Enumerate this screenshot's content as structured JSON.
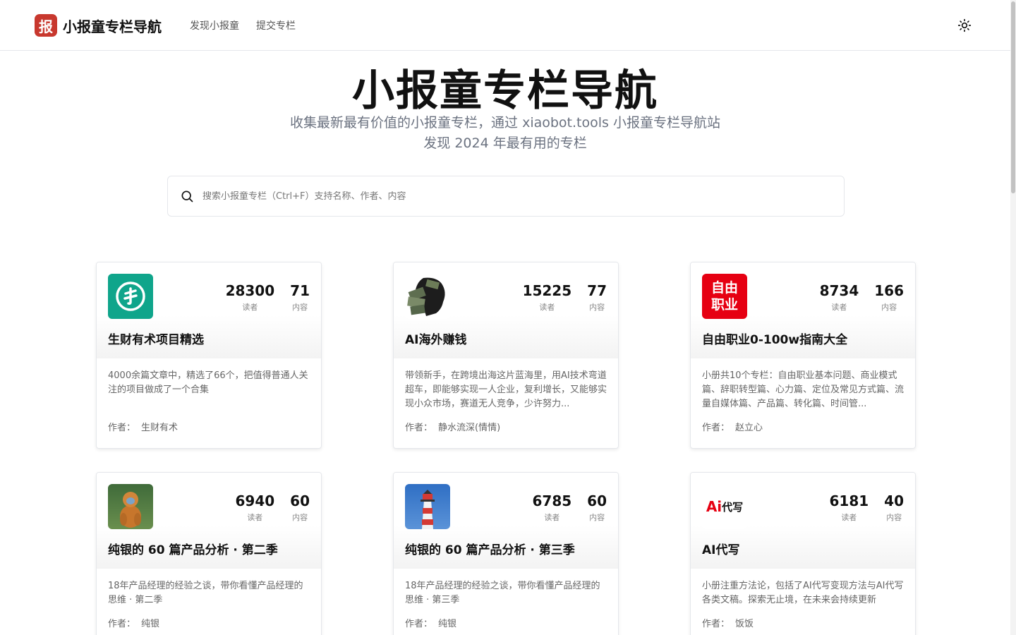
{
  "header": {
    "logo_char": "报",
    "site_name": "小报童专栏导航",
    "nav": [
      "发现小报童",
      "提交专栏"
    ],
    "theme_toggle_icon": "sun-icon"
  },
  "hero": {
    "title": "小报童专栏导航",
    "subtitle_line1": "收集最新最有价值的小报童专栏，通过 xiaobot.tools 小报童专栏导航站",
    "subtitle_line2": "发现 2024 年最有用的专栏"
  },
  "search": {
    "placeholder": "搜索小报童专栏（Ctrl+F）支持名称、作者、内容",
    "icon": "search-icon"
  },
  "labels": {
    "readers": "读者",
    "posts": "内容",
    "author": "作者："
  },
  "colors": {
    "logo_red": "#c8382e",
    "teal": "#0fa58b",
    "ziyou_red": "#e60012"
  },
  "cards": [
    {
      "title": "生财有术项目精选",
      "readers": "28300",
      "posts": "71",
      "description": "4000余篇文章中，精选了66个，把值得普通人关注的项目做成了一个合集",
      "author": "生财有术",
      "avatar": "shengcai-logo"
    },
    {
      "title": "AI海外赚钱",
      "readers": "15225",
      "posts": "77",
      "description": "带领新手，在跨境出海这片蓝海里，用AI技术弯道超车，即能够实现一人企业，复利增长，又能够实现小众市场，赛道无人竞争，少许努力...",
      "author": "静水流深(情情)",
      "avatar": "money-head-image"
    },
    {
      "title": "自由职业0-100w指南大全",
      "readers": "8734",
      "posts": "166",
      "description": "小册共10个专栏：自由职业基本问题、商业模式篇、辞职转型篇、心力篇、定位及常见方式篇、流量自媒体篇、产品篇、转化篇、时间管...",
      "author": "赵立心",
      "avatar": "ziyou-zhiye-logo",
      "avatar_text": [
        "自由",
        "职业"
      ]
    },
    {
      "title": "纯银的 60 篇产品分析 · 第二季",
      "readers": "6940",
      "posts": "60",
      "description": "18年产品经理的经验之谈，带你看懂产品经理的思维 · 第二季",
      "author": "纯银",
      "avatar": "monkey-photo"
    },
    {
      "title": "纯银的 60 篇产品分析 · 第三季",
      "readers": "6785",
      "posts": "60",
      "description": "18年产品经理的经验之谈，带你看懂产品经理的思维 · 第三季",
      "author": "纯银",
      "avatar": "lighthouse-photo"
    },
    {
      "title": "AI代写",
      "readers": "6181",
      "posts": "40",
      "description": "小册注重方法论，包括了AI代写变现方法与AI代写各类文稿。探索无止境，在未来会持续更新",
      "author": "饭饭",
      "avatar": "ai-daixie-logo",
      "avatar_text": [
        "Ai",
        "代写"
      ]
    }
  ]
}
